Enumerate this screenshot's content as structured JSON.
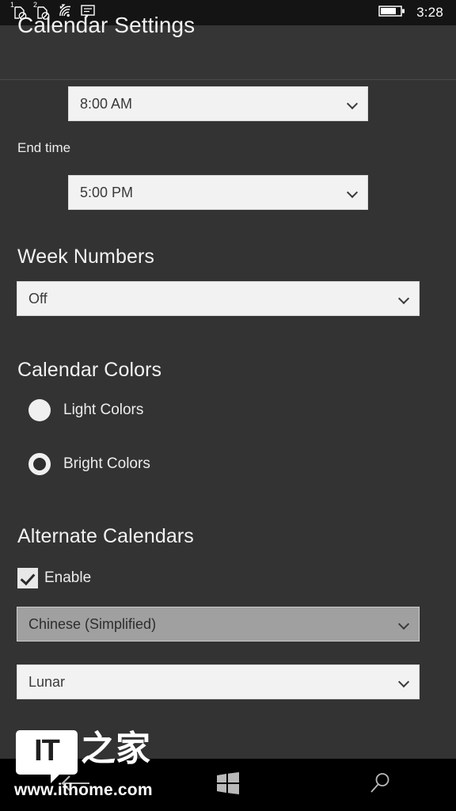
{
  "status_bar": {
    "sim1_icon": "sim-card-no-service-icon",
    "sim1_number": "1",
    "sim2_icon": "sim-card-no-service-icon",
    "sim2_number": "2",
    "wifi_icon": "wifi-signal-icon",
    "message_icon": "sms-message-icon",
    "battery_icon": "battery-icon",
    "battery_level_pct": 70,
    "clock": "3:28"
  },
  "header": {
    "title": "Calendar Settings"
  },
  "settings": {
    "start_time": {
      "value": "8:00 AM"
    },
    "end_time": {
      "label": "End time",
      "value": "5:00 PM"
    },
    "week_numbers": {
      "heading": "Week Numbers",
      "value": "Off"
    },
    "calendar_colors": {
      "heading": "Calendar Colors",
      "options": [
        {
          "label": "Light Colors",
          "state": "filled"
        },
        {
          "label": "Bright Colors",
          "state": "ring"
        }
      ]
    },
    "alternate_calendars": {
      "heading": "Alternate Calendars",
      "enable_label": "Enable",
      "enable_checked": true,
      "language": "Chinese (Simplified)",
      "calendar_type": "Lunar"
    }
  },
  "nav_bar": {
    "back_label": "back-arrow-icon",
    "start_label": "windows-start-icon",
    "search_label": "search-icon"
  },
  "watermark": {
    "logo_text": "IT",
    "cn_text": "之家",
    "url": "www.ithome.com"
  },
  "colors": {
    "page_bg": "#333333",
    "status_bar_bg": "#141414",
    "header_bg": "#353535",
    "nav_bar_bg": "#000000",
    "combo_bg": "#f2f2f2",
    "combo_pressed_bg": "#a0a0a0",
    "text": "#f2f2f2"
  }
}
